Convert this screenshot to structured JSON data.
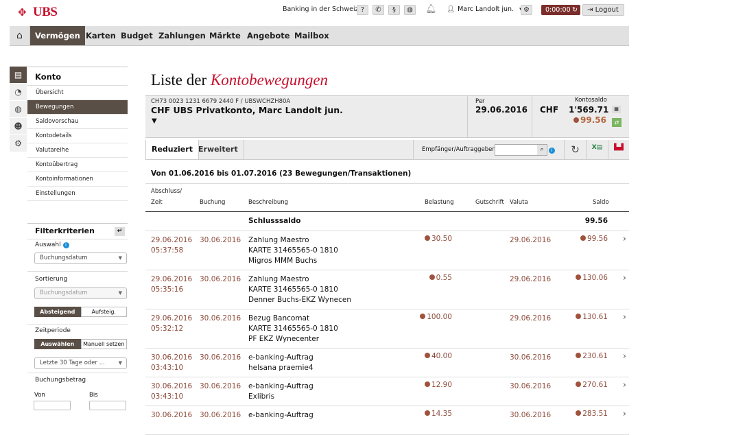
{
  "top": {
    "logo": "UBS",
    "region_link": "Banking in der Schweiz",
    "help_icon": "?",
    "phone_icon": "phone",
    "legal_icon": "§",
    "globe_icon": "globe",
    "bell_icon": "bell",
    "user_name": "Marc Landolt jun.",
    "timer": "0:00:00",
    "logout": "Logout"
  },
  "nav": {
    "items": [
      "Vermögen",
      "Karten",
      "Budget",
      "Zahlungen",
      "Märkte",
      "Angebote",
      "Mailbox"
    ]
  },
  "sidebar": {
    "heading": "Konto",
    "items": [
      "Übersicht",
      "Bewegungen",
      "Saldovorschau",
      "Kontodetails",
      "Valutareihe",
      "Kontoübertrag",
      "Kontoinformationen",
      "Einstellungen"
    ],
    "active_index": 1
  },
  "filter": {
    "title": "Filterkriterien",
    "auswahl_label": "Auswahl",
    "auswahl_value": "Buchungsdatum",
    "sortierung_label": "Sortierung",
    "sortierung_value": "Buchungsdatum",
    "sort_desc": "Absteigend",
    "sort_asc": "Aufsteig.",
    "zeitperiode_label": "Zeitperiode",
    "period_select": "Auswählen",
    "period_manual": "Manuell setzen",
    "period_value": "Letzte 30 Tage oder ...",
    "betrag_label": "Buchungsbetrag",
    "von_label": "Von",
    "bis_label": "Bis"
  },
  "page": {
    "title_plain": "Liste der",
    "title_accent": "Kontobewegungen"
  },
  "account": {
    "iban": "CH73 0023 1231 6679 2440 F / UBSWCHZH80A",
    "name": "CHF UBS Privatkonto, Marc Landolt jun.",
    "per_label": "Per",
    "per_date": "29.06.2016",
    "currency": "CHF",
    "saldo_label": "Kontosaldo",
    "saldo": "1'569.71",
    "pending": "99.56"
  },
  "tabs": {
    "reduced": "Reduziert",
    "extended": "Erweitert",
    "search_label": "Empfänger/Auftraggeber",
    "search_value": ""
  },
  "list": {
    "period_text": "Von 01.06.2016 bis 01.07.2016 (23 Bewegungen/Transaktionen)",
    "col_abschluss": "Abschluss/",
    "col_zeit": "Zeit",
    "col_buchung": "Buchung",
    "col_beschreibung": "Beschreibung",
    "col_belastung": "Belastung",
    "col_gutschrift": "Gutschrift",
    "col_valuta": "Valuta",
    "col_saldo": "Saldo",
    "closing_label": "Schlusssaldo",
    "closing_value": "99.56",
    "rows": [
      {
        "date": "29.06.2016",
        "time": "05:37:58",
        "booking": "30.06.2016",
        "desc1": "Zahlung Maestro",
        "desc2": "KARTE 31465565-0 1810",
        "desc3": "Migros MMM Buchs",
        "debit": "30.50",
        "credit": "",
        "valuta": "29.06.2016",
        "saldo": "99.56"
      },
      {
        "date": "29.06.2016",
        "time": "05:35:16",
        "booking": "30.06.2016",
        "desc1": "Zahlung Maestro",
        "desc2": "KARTE 31465565-0 1810",
        "desc3": "Denner Buchs-EKZ Wynecen",
        "debit": "0.55",
        "credit": "",
        "valuta": "29.06.2016",
        "saldo": "130.06"
      },
      {
        "date": "29.06.2016",
        "time": "05:32:12",
        "booking": "30.06.2016",
        "desc1": "Bezug Bancomat",
        "desc2": "KARTE 31465565-0 1810",
        "desc3": "PF EKZ Wynecenter",
        "debit": "100.00",
        "credit": "",
        "valuta": "29.06.2016",
        "saldo": "130.61"
      },
      {
        "date": "30.06.2016",
        "time": "03:43:10",
        "booking": "30.06.2016",
        "desc1": "e-banking-Auftrag",
        "desc2": "helsana praemie4",
        "desc3": "",
        "debit": "40.00",
        "credit": "",
        "valuta": "30.06.2016",
        "saldo": "230.61"
      },
      {
        "date": "30.06.2016",
        "time": "03:43:10",
        "booking": "30.06.2016",
        "desc1": "e-banking-Auftrag",
        "desc2": "Exlibris",
        "desc3": "",
        "debit": "12.90",
        "credit": "",
        "valuta": "30.06.2016",
        "saldo": "270.61"
      },
      {
        "date": "30.06.2016",
        "time": "",
        "booking": "30.06.2016",
        "desc1": "e-banking-Auftrag",
        "desc2": "",
        "desc3": "",
        "debit": "14.35",
        "credit": "",
        "valuta": "30.06.2016",
        "saldo": "283.51"
      }
    ]
  },
  "colors": {
    "brand_red": "#c8102e",
    "active_bg": "#5a4f46",
    "amount_brown": "#8c4a3a"
  }
}
